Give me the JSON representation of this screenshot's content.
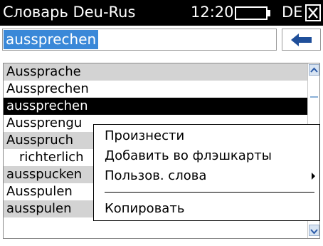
{
  "titlebar": {
    "title": "Словарь Deu-Rus",
    "time": "12:20",
    "language": "DE",
    "icons": {
      "battery": "battery-icon",
      "close": "close-icon"
    }
  },
  "search": {
    "value": "aussprechen",
    "back_icon": "back-arrow-icon"
  },
  "list": {
    "items": [
      {
        "label": "Aussprache",
        "style": "grey"
      },
      {
        "label": "Aussprechen",
        "style": "white"
      },
      {
        "label": "aussprechen",
        "style": "selected"
      },
      {
        "label": "Aussprengu",
        "style": "white"
      },
      {
        "label": "Ausspruch",
        "style": "grey"
      },
      {
        "label": "richterlich",
        "style": "white"
      },
      {
        "label": "ausspucken",
        "style": "grey"
      },
      {
        "label": "Ausspulen",
        "style": "white"
      },
      {
        "label": "ausspulen",
        "style": "grey"
      }
    ],
    "scroll_icons": {
      "up": "scroll-up-icon",
      "down": "scroll-down-icon"
    }
  },
  "context_menu": {
    "items": [
      {
        "label": "Произнести"
      },
      {
        "label": "Добавить во флэшкарты"
      },
      {
        "label": "Пользов. слова",
        "has_submenu": true
      },
      {
        "label": "Копировать"
      }
    ]
  },
  "colors": {
    "titlebar_bg": "#000000",
    "selection_bg": "#3a88d8",
    "row_grey": "#d3d3d3",
    "selected_row": "#000000"
  }
}
